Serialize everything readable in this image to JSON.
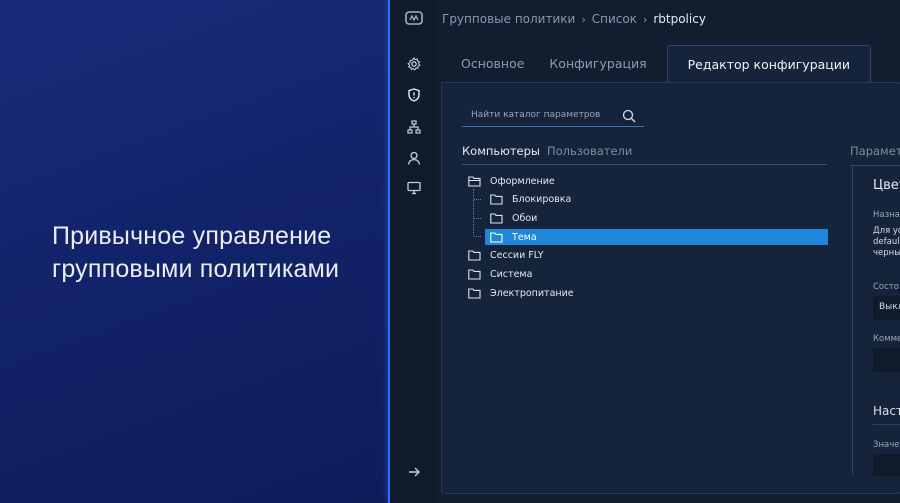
{
  "promo": {
    "headline_line1": "Привычное управление",
    "headline_line2": "групповыми политиками",
    "accent_color": "#2f6bff"
  },
  "rail": {
    "icons": [
      "app-logo-icon",
      "settings-icon",
      "shield-icon",
      "hierarchy-icon",
      "user-icon",
      "monitor-icon",
      "arrow-right-icon"
    ]
  },
  "breadcrumb": {
    "items": [
      "Групповые политики",
      "Список"
    ],
    "current": "rbtpolicy"
  },
  "tabs": {
    "main": "Основное",
    "config": "Конфигурация",
    "editor": "Редактор конфигурации",
    "active": "Редактор конфигурации"
  },
  "search": {
    "placeholder": "Найти каталог параметров"
  },
  "subtabs": {
    "computers": "Компьютеры",
    "users": "Пользователи"
  },
  "params_title": "Парамет",
  "tree": {
    "root1": "Оформление",
    "child1": "Блокировка",
    "child2": "Обои",
    "child3": "Тема",
    "root2": "Сессии FLY",
    "root3": "Система",
    "root4": "Электропитание",
    "selected": "Тема",
    "selected_color": "#1e87d9"
  },
  "details": {
    "title": "Цвет",
    "purpose_label": "Назнач",
    "desc_line1": "Для ус",
    "desc_line2": "default",
    "desc_line3": "черны",
    "state_label": "Состо",
    "state_value": "Выкл",
    "comment_label": "Комме",
    "settings_section": "Наст",
    "value_label": "Значен"
  }
}
